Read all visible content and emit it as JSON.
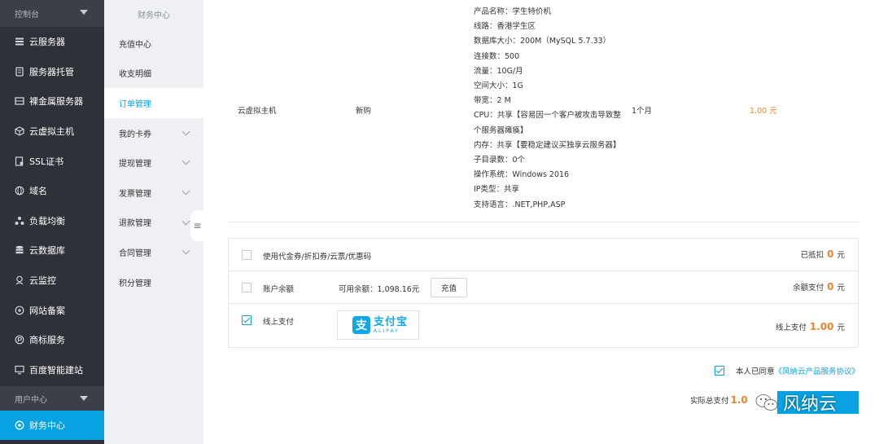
{
  "sidebar": {
    "console_header": "控制台",
    "items": [
      {
        "label": "云服务器",
        "icon": "server-icon"
      },
      {
        "label": "服务器托管",
        "icon": "hosting-icon"
      },
      {
        "label": "裸金属服务器",
        "icon": "bare-metal-icon"
      },
      {
        "label": "云虚拟主机",
        "icon": "cube-icon"
      },
      {
        "label": "SSL证书",
        "icon": "certificate-icon"
      },
      {
        "label": "域名",
        "icon": "globe-icon"
      },
      {
        "label": "负载均衡",
        "icon": "load-balance-icon"
      },
      {
        "label": "云数据库",
        "icon": "database-icon"
      },
      {
        "label": "云监控",
        "icon": "monitor-icon"
      },
      {
        "label": "网站备案",
        "icon": "record-icon"
      },
      {
        "label": "商标服务",
        "icon": "trademark-icon"
      },
      {
        "label": "百度智能建站",
        "icon": "site-builder-icon"
      }
    ],
    "user_header": "用户中心",
    "active_item": {
      "label": "财务中心",
      "icon": "finance-icon"
    }
  },
  "submenu": {
    "title": "财务中心",
    "items": [
      {
        "label": "充值中心",
        "has_children": false
      },
      {
        "label": "收支明细",
        "has_children": false
      },
      {
        "label": "订单管理",
        "has_children": false,
        "active": true
      },
      {
        "label": "我的卡券",
        "has_children": true
      },
      {
        "label": "提现管理",
        "has_children": true
      },
      {
        "label": "发票管理",
        "has_children": true
      },
      {
        "label": "退款管理",
        "has_children": true
      },
      {
        "label": "合同管理",
        "has_children": true
      },
      {
        "label": "积分管理",
        "has_children": false
      }
    ],
    "collapse_glyph": "≡"
  },
  "order": {
    "product": "云虚拟主机",
    "type": "新购",
    "period": "1个月",
    "price": "1.00 元",
    "specs": [
      "产品名称：学生特价机",
      "线路：香港学生区",
      "数据库大小：200M（MySQL 5.7.33）",
      "连接数：500",
      "流量：10G/月",
      "空间大小：1G",
      "带宽：2 M",
      "CPU：共享【容易因一个客户被攻击导致整",
      "个服务器瘫痪】",
      "内存：共享【要稳定建议买独享云服务器】",
      "子目录数：0个",
      "操作系统：Windows 2016",
      "IP类型：共享",
      "支持语言：.NET,PHP,ASP"
    ]
  },
  "payment": {
    "coupon": {
      "label": "使用代金券/折扣券/云票/优惠码",
      "right_label": "已抵扣",
      "amount": "0",
      "unit": "元",
      "checked": false
    },
    "balance": {
      "label": "账户余额",
      "available": "可用余额：1,098.16元",
      "recharge_label": "充值",
      "right_label": "余额支付",
      "amount": "0",
      "unit": "元",
      "checked": false
    },
    "online": {
      "label": "线上支付",
      "right_label": "线上支付",
      "amount": "1.00",
      "unit": "元",
      "checked": true,
      "alipay_glyph": "支",
      "alipay_cn": "支付宝",
      "alipay_en": "ALIPAY"
    }
  },
  "agreement": {
    "prefix": "本人已同意",
    "link": "《风纳云产品服务协议》",
    "checked": true
  },
  "total": {
    "label": "实际总支付",
    "amount": "1.0"
  },
  "watermark": {
    "text": "风纳云"
  },
  "colors": {
    "sidebar_bg": "#2e3238",
    "accent": "#08a2e3",
    "price": "#f5822a",
    "submenu_bg": "#eef0f3"
  }
}
